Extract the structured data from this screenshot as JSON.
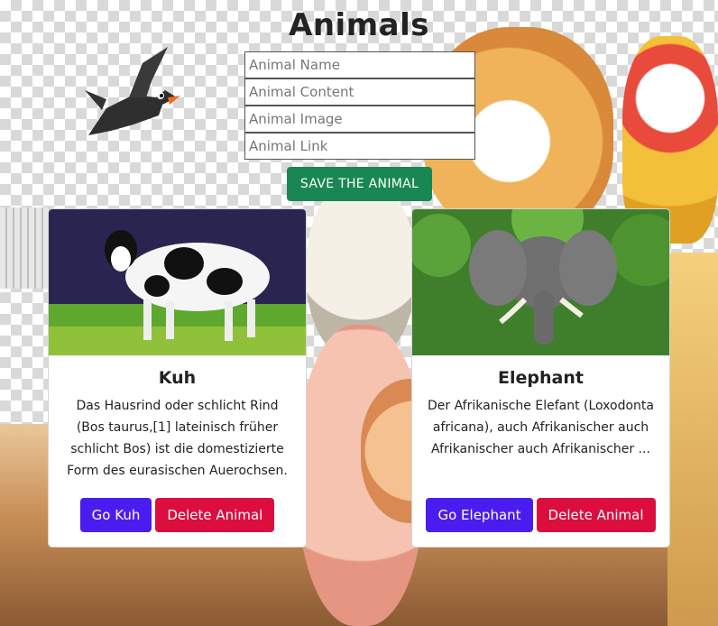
{
  "page": {
    "title": "Animals"
  },
  "form": {
    "name_placeholder": "Animal Name",
    "content_placeholder": "Animal Content",
    "image_placeholder": "Animal Image",
    "link_placeholder": "Animal Link",
    "save_label": "SAVE THE ANIMAL"
  },
  "colors": {
    "save": "#198754",
    "go": "#4b1cf0",
    "delete": "#dc0e3e"
  },
  "cards": [
    {
      "name": "Kuh",
      "image_icon": "cow-photo",
      "text": "Das Hausrind oder schlicht Rind (Bos taurus,[1] lateinisch früher schlicht Bos) ist die domestizierte Form des eurasischen Auerochsen.",
      "go_label": "Go Kuh",
      "delete_label": "Delete Animal"
    },
    {
      "name": "Elephant",
      "image_icon": "elephant-photo",
      "text": "Der Afrikanische Elefant (Loxodonta africana), auch Afrikanischer auch Afrikanischer auch Afrikanischer ...",
      "go_label": "Go Elephant",
      "delete_label": "Delete Animal"
    }
  ]
}
